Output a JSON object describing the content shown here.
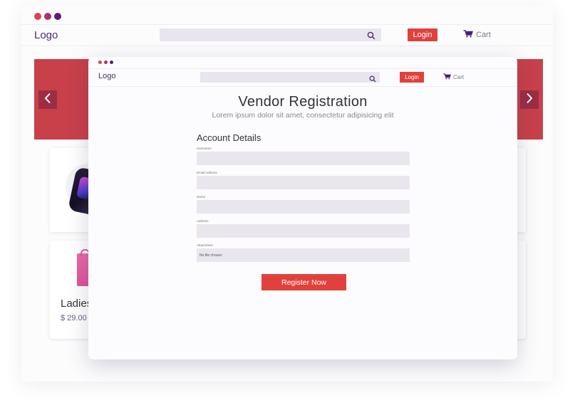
{
  "colors": {
    "accent_red": "#e0413d",
    "brand_purple": "#4a2d6e",
    "banner_red": "#c8404a",
    "dot_colors": [
      "#e0414f",
      "#a8326e",
      "#5a1f72"
    ]
  },
  "back_window": {
    "header": {
      "logo": "Logo",
      "search_icon": "search-icon",
      "login_label": "Login",
      "cart_label": "Cart",
      "cart_icon": "cart-icon"
    },
    "banner": {
      "left_arrow_icon": "chevron-left-icon",
      "right_arrow_icon": "chevron-right-icon"
    },
    "products": [
      {
        "name": "",
        "price": "",
        "image": "smartwatch"
      },
      {
        "name": "Ladies",
        "price": "$ 29.00",
        "image": "pink-bag"
      }
    ]
  },
  "front_window": {
    "header": {
      "logo": "Logo",
      "search_icon": "search-icon",
      "login_label": "Login",
      "cart_label": "Cart",
      "cart_icon": "cart-icon"
    },
    "title": "Vendor Registration",
    "subtitle": "Lorem ipsum dolor sit amet, consectetur adipisicing elit",
    "section_title": "Account Details",
    "fields": [
      {
        "label": "Username",
        "value": ""
      },
      {
        "label": "Email Address",
        "value": ""
      },
      {
        "label": "Name",
        "value": ""
      },
      {
        "label": "Address",
        "value": ""
      },
      {
        "label": "Attachment",
        "value": "No file chosen"
      }
    ],
    "submit_label": "Register Now"
  }
}
